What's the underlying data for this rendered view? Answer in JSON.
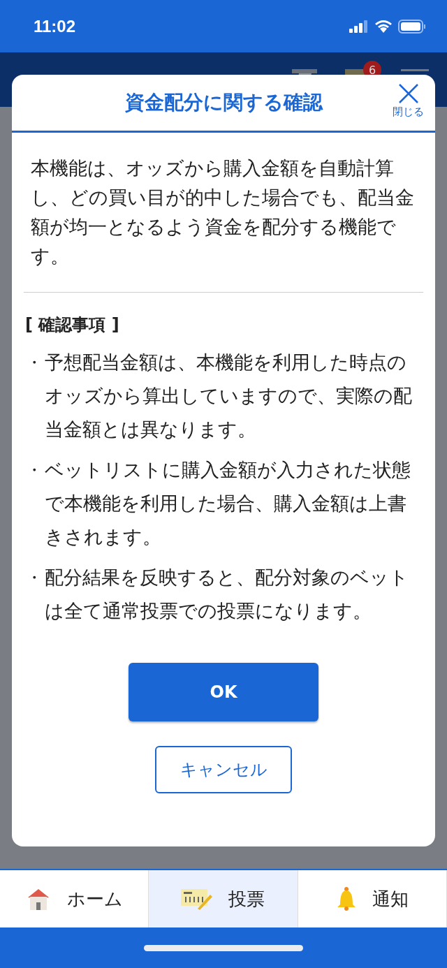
{
  "status_bar": {
    "time": "11:02"
  },
  "header": {
    "badge": "6"
  },
  "dialog": {
    "title": "資金配分に関する確認",
    "close_label": "閉じる",
    "intro": "本機能は、オッズから購入金額を自動計算し、どの買い目が的中した場合でも、配当金額が均一となるよう資金を配分する機能です。",
    "section_heading": "[ 確認事項 ]",
    "notes": [
      {
        "marker": "・",
        "text": "予想配当金額は、本機能を利用した時点のオッズから算出していますので、実際の配当金額とは異なります。"
      },
      {
        "marker": "・",
        "text": "ベットリストに購入金額が入力された状態で本機能を利用した場合、購入金額は上書きされます。"
      },
      {
        "marker": "・",
        "text": "配分結果を反映すると、配分対象のベットは全て通常投票での投票になります。"
      }
    ],
    "buttons": [
      {
        "label": "OK",
        "kind": "primary"
      },
      {
        "label": "キャンセル",
        "kind": "secondary"
      }
    ]
  },
  "tab_bar": [
    {
      "label": "ホーム",
      "kind": "home",
      "selected": false
    },
    {
      "label": "投票",
      "kind": "vote",
      "selected": true
    },
    {
      "label": "通知",
      "kind": "notice",
      "selected": false
    }
  ]
}
